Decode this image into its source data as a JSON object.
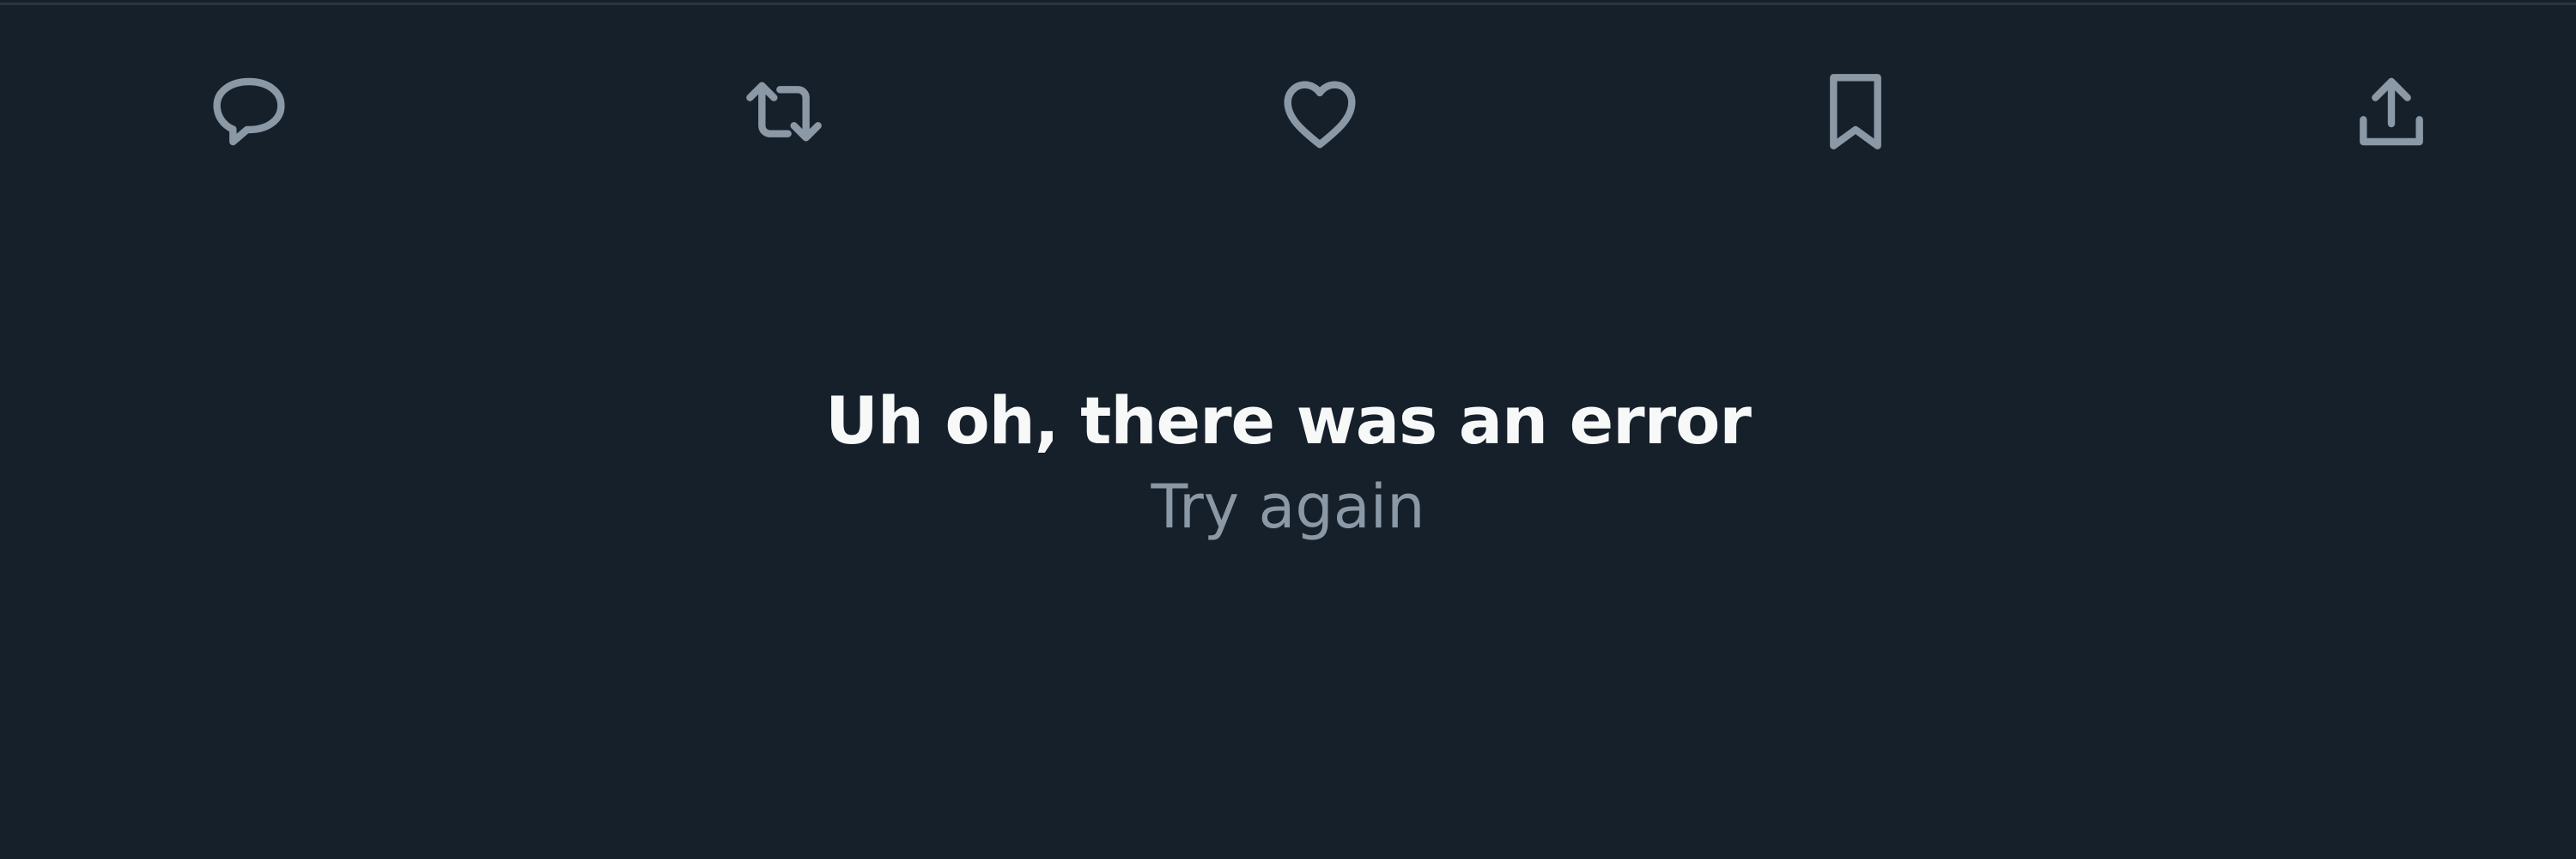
{
  "theme": {
    "background": "#16202b",
    "divider": "#2b3640",
    "icon_color": "#8b98a5",
    "primary_text": "#f7f9f9",
    "secondary_text": "#8b98a5"
  },
  "action_bar": {
    "actions": [
      {
        "name": "reply",
        "icon": "speech-bubble-icon"
      },
      {
        "name": "repost",
        "icon": "repost-arrows-icon"
      },
      {
        "name": "like",
        "icon": "heart-icon"
      },
      {
        "name": "bookmark",
        "icon": "bookmark-icon"
      },
      {
        "name": "share",
        "icon": "share-upload-icon"
      }
    ]
  },
  "error": {
    "title": "Uh oh, there was an error",
    "retry_label": "Try again"
  }
}
